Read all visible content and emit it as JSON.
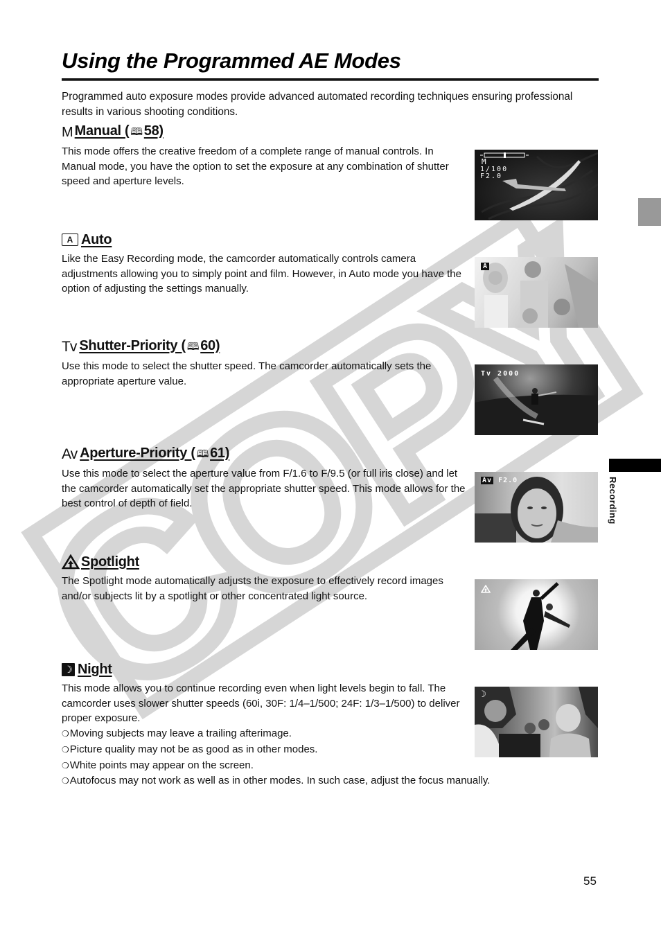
{
  "page": {
    "title": "Using the Programmed AE Modes",
    "intro": "Programmed auto exposure modes provide advanced automated recording techniques ensuring professional results in various shooting conditions.",
    "side_tab_label": "Recording",
    "page_number": "55",
    "watermark": "COPY"
  },
  "sections": [
    {
      "icon": "M",
      "icon_name": "manual-mode-icon",
      "title": "Manual (",
      "page_ref": "58)",
      "body": "This mode offers the creative freedom of a complete range of manual controls. In Manual mode, you have the option to set the exposure at any combination of shutter speed and aperture levels.",
      "photo": {
        "subject": "glider in flight",
        "osd_lines": [
          "M",
          "1/100",
          "F2.0"
        ],
        "osd_meter": true
      }
    },
    {
      "icon": "A",
      "icon_name": "auto-mode-icon",
      "title": "Auto",
      "body": "Like the Easy Recording mode, the camcorder automatically controls camera adjustments allowing you to simply point and film. However, in Auto mode you have the option of adjusting the settings manually.",
      "photo": {
        "subject": "smiling family on beach",
        "osd_lines": [
          "A"
        ]
      }
    },
    {
      "icon": "Tv",
      "icon_name": "shutter-priority-icon",
      "title": "Shutter-Priority (",
      "page_ref": "60)",
      "body": "Use this mode to select the shutter speed. The camcorder automatically sets the appropriate aperture value.",
      "photo": {
        "subject": "surfer on wave",
        "osd_lines": [
          "Tv  2000"
        ]
      }
    },
    {
      "icon": "Av",
      "icon_name": "aperture-priority-icon",
      "title": "Aperture-Priority (",
      "page_ref": "61)",
      "body": "Use this mode to select the aperture value from F/1.6 to F/9.5 (or full iris close) and let the camcorder automatically set the appropriate shutter speed. This mode allows for the best control of depth of field.",
      "photo": {
        "subject": "girl portrait",
        "osd_lines": [
          "Av",
          "F2.0"
        ]
      }
    },
    {
      "icon": "△",
      "icon_name": "spotlight-icon",
      "title": "Spotlight",
      "body": "The Spotlight mode automatically adjusts the exposure to effectively record images and/or subjects lit by a spotlight or other concentrated light source.",
      "photo": {
        "subject": "dancers under spotlight",
        "osd_lines": [
          "spotlight"
        ]
      }
    },
    {
      "icon": "☽",
      "icon_name": "night-mode-icon",
      "title": "Night",
      "body": "This mode allows you to continue recording even when light levels begin to fall. The camcorder uses slower shutter speeds (60i, 30F: 1/4–1/500; 24F: 1/3–1/500) to deliver proper exposure.",
      "bullets": [
        "Moving subjects may leave a trailing afterimage.",
        "Picture quality may not be as good as in other modes.",
        "White points may appear on the screen.",
        "Autofocus may not work as well as in other modes. In such case, adjust the focus manually."
      ],
      "photo": {
        "subject": "people in restaurant at night",
        "osd_lines": [
          "night"
        ]
      }
    }
  ]
}
